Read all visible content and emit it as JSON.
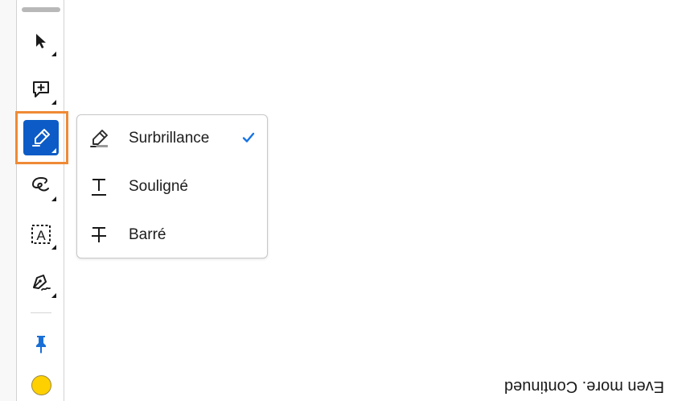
{
  "toolbar": {
    "tools": [
      {
        "name": "select",
        "icon": "pointer-arrow-icon"
      },
      {
        "name": "comment",
        "icon": "add-comment-icon"
      },
      {
        "name": "highlight",
        "icon": "highlighter-pen-icon",
        "active": true
      },
      {
        "name": "draw",
        "icon": "freehand-loop-icon"
      },
      {
        "name": "text-box",
        "icon": "text-box-icon",
        "glyph": "A"
      },
      {
        "name": "sign",
        "icon": "fountain-pen-sign-icon"
      },
      {
        "name": "pin",
        "icon": "pin-icon"
      }
    ],
    "current_color": "#ffd000",
    "active_color": "#0d5bc6",
    "focus_color": "#ef8a35"
  },
  "markup_menu": {
    "items": [
      {
        "label": "Surbrillance",
        "icon": "highlight-icon",
        "checked": true
      },
      {
        "label": "Souligné",
        "icon": "underline-icon",
        "checked": false
      },
      {
        "label": "Barré",
        "icon": "strikethrough-icon",
        "checked": false
      }
    ],
    "check_color": "#1473e6"
  },
  "document": {
    "visible_text": "Even more. Continued"
  }
}
